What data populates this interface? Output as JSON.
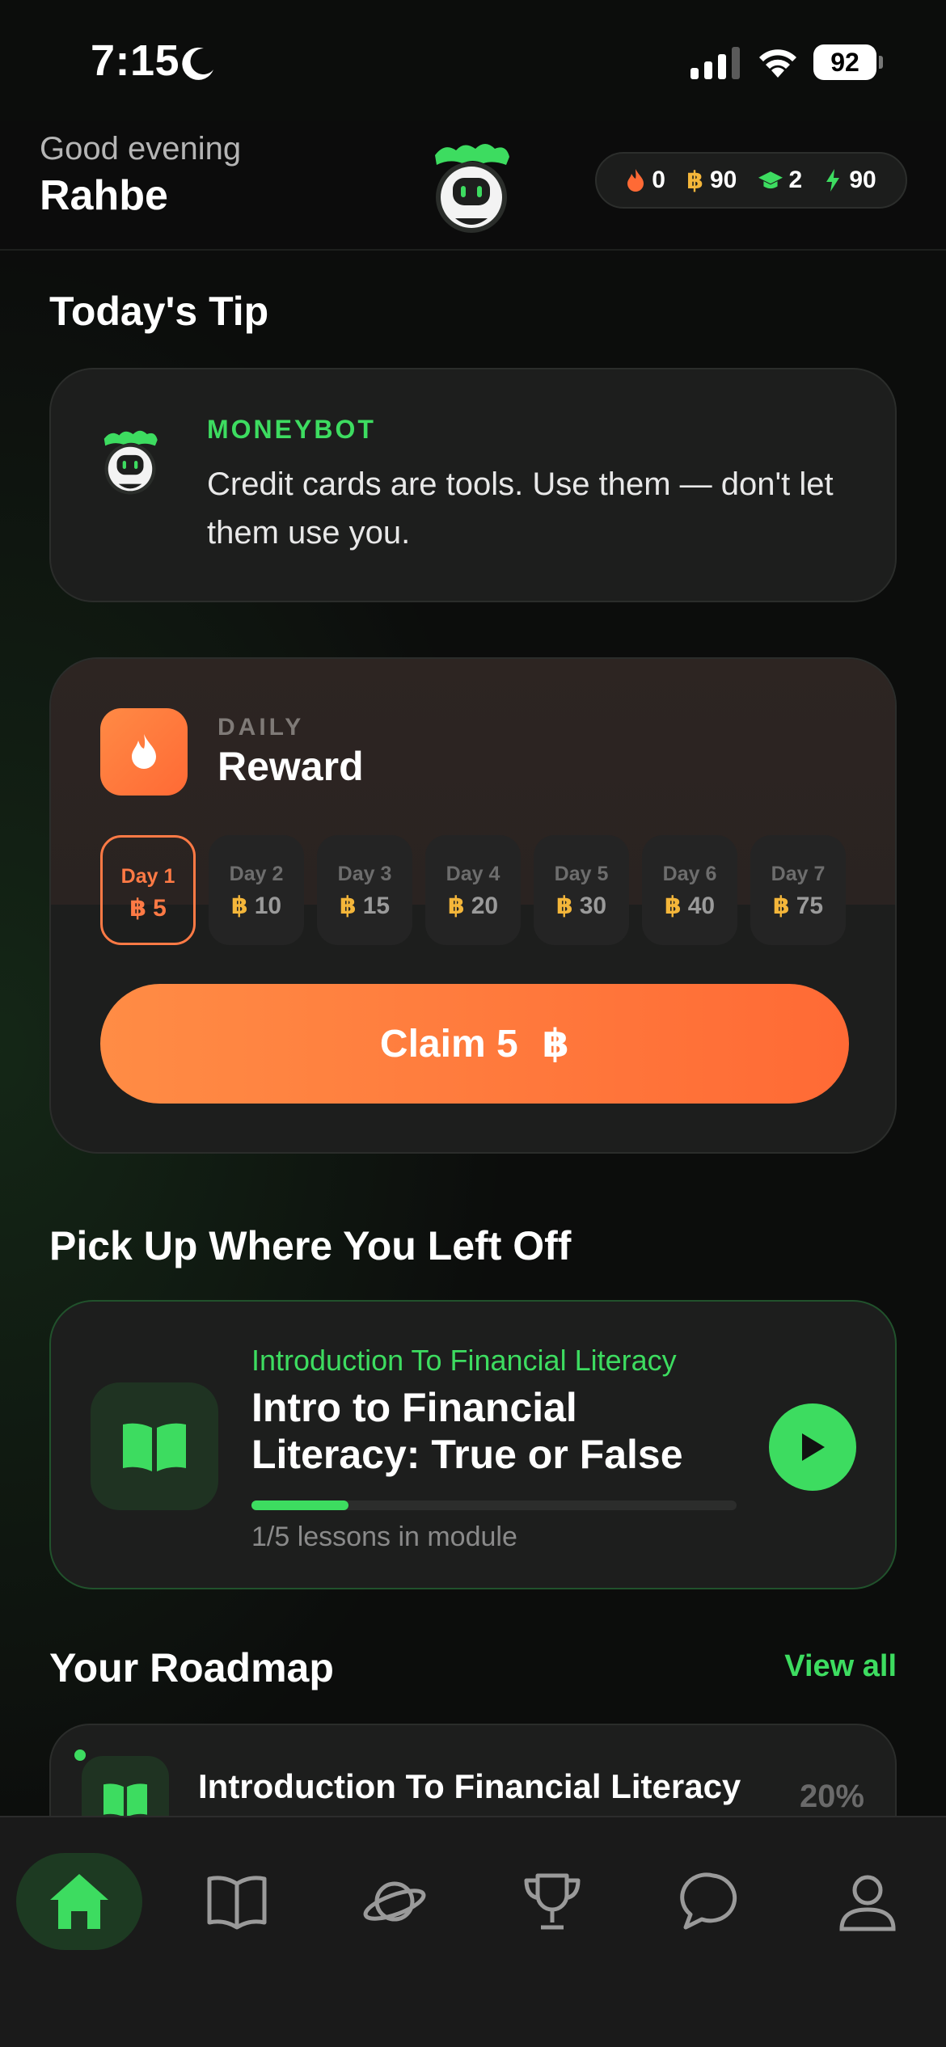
{
  "status_bar": {
    "time": "7:15",
    "battery": "92"
  },
  "header": {
    "greeting": "Good evening",
    "username": "Rahbe",
    "stats": {
      "streak": "0",
      "coins": "90",
      "level": "2",
      "energy": "90"
    }
  },
  "tip": {
    "section_title": "Today's Tip",
    "source": "MONEYBOT",
    "text": "Credit cards are tools. Use them — don't let them use you."
  },
  "daily_reward": {
    "kicker": "DAILY",
    "title": "Reward",
    "coin_symbol": "฿",
    "days": [
      {
        "label": "Day 1",
        "amount": "5",
        "active": true
      },
      {
        "label": "Day 2",
        "amount": "10",
        "active": false
      },
      {
        "label": "Day 3",
        "amount": "15",
        "active": false
      },
      {
        "label": "Day 4",
        "amount": "20",
        "active": false
      },
      {
        "label": "Day 5",
        "amount": "30",
        "active": false
      },
      {
        "label": "Day 6",
        "amount": "40",
        "active": false
      },
      {
        "label": "Day 7",
        "amount": "75",
        "active": false
      }
    ],
    "claim_label": "Claim 5"
  },
  "continue": {
    "section_title": "Pick Up Where You Left Off",
    "module": "Introduction To Financial Literacy",
    "title": "Intro to Financial Literacy: True or False",
    "progress": 0.2,
    "subtitle": "1/5 lessons in module"
  },
  "roadmap": {
    "section_title": "Your Roadmap",
    "view_all": "View all",
    "first_item": {
      "title": "Introduction To Financial Literacy",
      "percent": "20%"
    }
  },
  "nav": {
    "active": "home",
    "items": [
      "home-icon",
      "book-icon",
      "planet-icon",
      "trophy-icon",
      "chat-icon",
      "profile-icon"
    ]
  },
  "colors": {
    "accent_green": "#3ddc60",
    "accent_orange": "#ff7a45",
    "coin_gold": "#f4b63a",
    "background": "#0c0d0c",
    "card": "#1d1e1d"
  }
}
